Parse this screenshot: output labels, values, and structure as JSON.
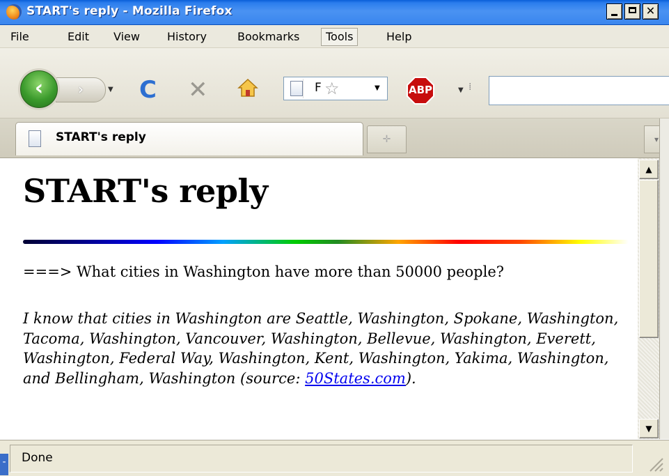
{
  "window": {
    "title": "START's reply - Mozilla Firefox",
    "minimize_label": "_",
    "maximize_label": "□",
    "close_label": "✕"
  },
  "menubar": {
    "items": [
      "File",
      "Edit",
      "View",
      "History",
      "Bookmarks",
      "Tools",
      "Help"
    ],
    "active": "Tools"
  },
  "toolbar": {
    "back_icon": "back-arrow-icon",
    "forward_icon": "forward-arrow-icon",
    "reload_glyph": "C",
    "stop_glyph": "✕",
    "url_partial": "F",
    "adblock_label": "ABP"
  },
  "tabs": [
    {
      "label": "START's reply",
      "selected": true
    }
  ],
  "page": {
    "heading": "START's reply",
    "question": "===> What cities in Washington have more than 50000 people?",
    "answer_text": "I know that cities in Washington are Seattle, Washington, Spokane, Washington, Tacoma, Washington, Vancouver, Washington, Bellevue, Washington, Everett, Washington, Federal Way, Washington, Kent, Washington, Yakima, Washington, and Bellingham, Washington (source: ",
    "source_link": "50States.com",
    "answer_end": ")."
  },
  "statusbar": {
    "text": "Done"
  },
  "colors": {
    "titlebar": "#2b7ded",
    "link": "#0000ee",
    "chrome": "#ece9d8"
  }
}
